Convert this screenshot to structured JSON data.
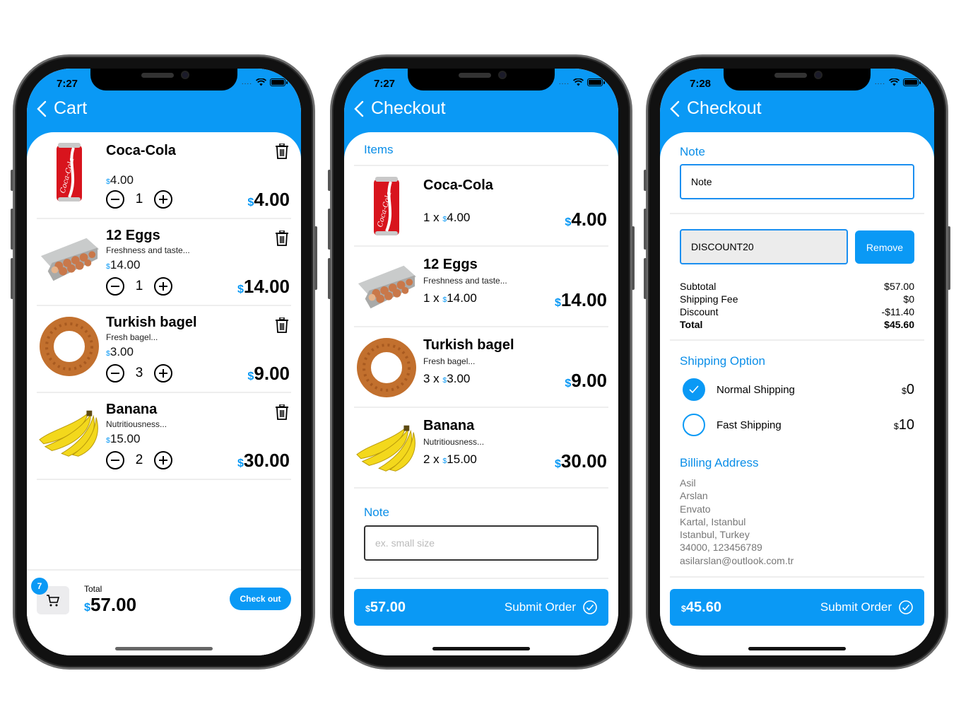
{
  "theme": {
    "accent": "#0a99f5",
    "background": "#ffffff"
  },
  "currency_symbol": "$",
  "screens": [
    {
      "status_time": "7:27",
      "nav_title": "Cart",
      "items": [
        {
          "name": "Coca-Cola",
          "description": "",
          "unit_price": "4.00",
          "quantity": "1",
          "line_total": "4.00",
          "image": "coca-cola-can"
        },
        {
          "name": "12 Eggs",
          "description": "Freshness and taste...",
          "unit_price": "14.00",
          "quantity": "1",
          "line_total": "14.00",
          "image": "egg-carton"
        },
        {
          "name": "Turkish bagel",
          "description": "Fresh bagel...",
          "unit_price": "3.00",
          "quantity": "3",
          "line_total": "9.00",
          "image": "simit-bagel"
        },
        {
          "name": "Banana",
          "description": "Nutritiousness...",
          "unit_price": "15.00",
          "quantity": "2",
          "line_total": "30.00",
          "image": "banana-bunch"
        }
      ],
      "footer": {
        "badge_count": "7",
        "total_label": "Total",
        "total": "57.00",
        "checkout_label": "Check out"
      }
    },
    {
      "status_time": "7:27",
      "nav_title": "Checkout",
      "items_title": "Items",
      "items": [
        {
          "name": "Coca-Cola",
          "description": "",
          "quantity_prefix": "1 x",
          "unit_price": "4.00",
          "line_total": "4.00"
        },
        {
          "name": "12 Eggs",
          "description": "Freshness and taste...",
          "quantity_prefix": "1 x",
          "unit_price": "14.00",
          "line_total": "14.00"
        },
        {
          "name": "Turkish bagel",
          "description": "Fresh bagel...",
          "quantity_prefix": "3 x",
          "unit_price": "3.00",
          "line_total": "9.00"
        },
        {
          "name": "Banana",
          "description": "Nutritiousness...",
          "quantity_prefix": "2 x",
          "unit_price": "15.00",
          "line_total": "30.00"
        }
      ],
      "note_title": "Note",
      "note_placeholder": "ex. small size",
      "note_value": "",
      "submit": {
        "total": "57.00",
        "label": "Submit Order"
      }
    },
    {
      "status_time": "7:28",
      "nav_title": "Checkout",
      "note_title": "Note",
      "note_value": "Note",
      "coupon_value": "DISCOUNT20",
      "remove_label": "Remove",
      "summary": [
        {
          "label": "Subtotal",
          "value": "$57.00"
        },
        {
          "label": "Shipping Fee",
          "value": "$0"
        },
        {
          "label": "Discount",
          "value": "-$11.40"
        },
        {
          "label": "Total",
          "value": "$45.60"
        }
      ],
      "shipping_title": "Shipping Option",
      "shipping_options": [
        {
          "label": "Normal Shipping",
          "price": "0",
          "selected": true
        },
        {
          "label": "Fast Shipping",
          "price": "10",
          "selected": false
        }
      ],
      "billing_title": "Billing Address",
      "billing_lines": [
        "Asil",
        "Arslan",
        "Envato",
        "Kartal, Istanbul",
        "Istanbul, Turkey",
        "34000, 123456789",
        "asilarslan@outlook.com.tr"
      ],
      "submit": {
        "total": "45.60",
        "label": "Submit Order"
      }
    }
  ]
}
